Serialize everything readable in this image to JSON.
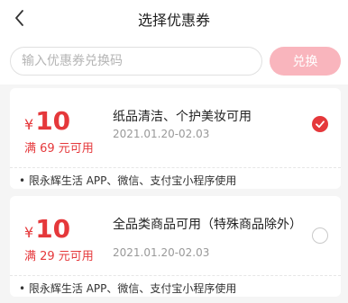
{
  "header": {
    "title": "选择优惠券",
    "back_icon": "chevron-left-icon"
  },
  "redeem": {
    "placeholder": "输入优惠券兑换码",
    "value": "",
    "button_label": "兑换",
    "button_color": "#f9b5bd"
  },
  "accent_color": "#e5383b",
  "coupons": [
    {
      "currency": "¥",
      "amount": "10",
      "condition": "满 69 元可用",
      "name": "纸品清洁、个护美妆可用",
      "dates": "2021.01.20-02.03",
      "scope": "• 限永辉生活 APP、微信、支付宝小程序使用",
      "selected": true
    },
    {
      "currency": "¥",
      "amount": "10",
      "condition": "满 29 元可用",
      "name": "全品类商品可用（特殊商品除外）",
      "dates": "2021.01.20-02.03",
      "scope": "• 限永辉生活 APP、微信、支付宝小程序使用",
      "selected": false
    }
  ]
}
